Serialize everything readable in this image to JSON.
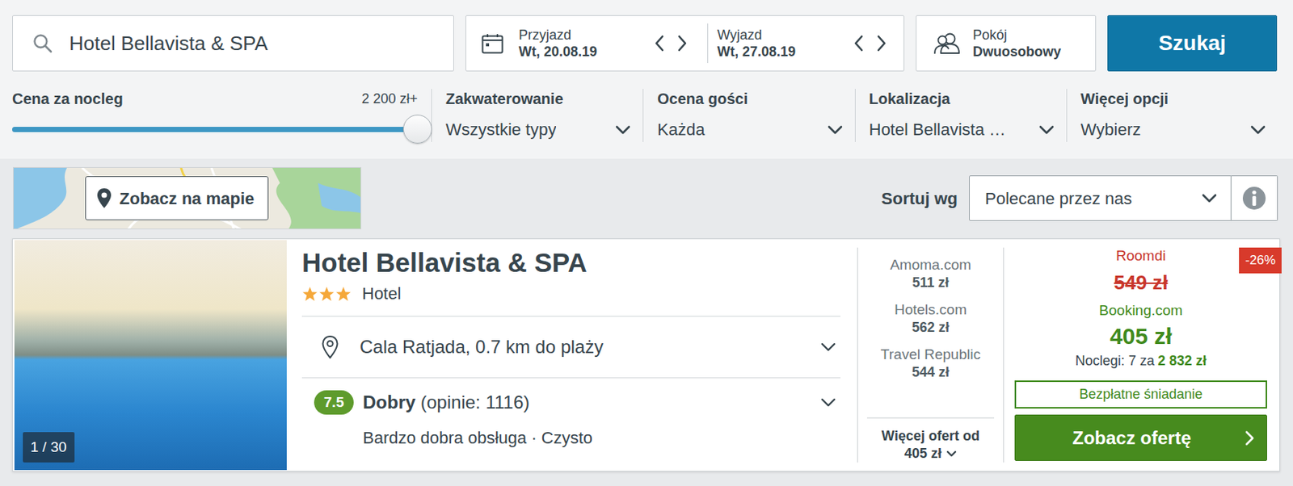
{
  "search": {
    "value": "Hotel Bellavista & SPA"
  },
  "dates": {
    "checkin": {
      "label": "Przyjazd",
      "value": "Wt, 20.08.19"
    },
    "checkout": {
      "label": "Wyjazd",
      "value": "Wt, 27.08.19"
    }
  },
  "room": {
    "label": "Pokój",
    "value": "Dwuosobowy"
  },
  "search_button": "Szukaj",
  "filters": {
    "price": {
      "label": "Cena za nocleg",
      "reading": "2 200 zł+",
      "level": 1
    },
    "dropdowns": [
      {
        "label": "Zakwaterowanie",
        "value": "Wszystkie typy"
      },
      {
        "label": "Ocena gości",
        "value": "Każda"
      },
      {
        "label": "Lokalizacja",
        "value": "Hotel Bellavista …"
      },
      {
        "label": "Więcej opcji",
        "value": "Wybierz"
      }
    ]
  },
  "map_button": "Zobacz na mapie",
  "sort": {
    "label": "Sortuj wg",
    "value": "Polecane przez nas"
  },
  "hotel": {
    "name": "Hotel Bellavista & SPA",
    "stars": 3,
    "type": "Hotel",
    "photo_counter": "1 / 30",
    "location": "Cala Ratjada, 0.7 km do plaży",
    "rating": {
      "score": "7.5",
      "word": "Dobry",
      "count": "(opinie: 1116)",
      "highlights": "Bardzo dobra obsługa · Czysto"
    },
    "offers": [
      {
        "site": "Amoma.com",
        "price": "511 zł"
      },
      {
        "site": "Hotels.com",
        "price": "562 zł"
      },
      {
        "site": "Travel Republic",
        "price": "544 zł"
      }
    ],
    "more_offers": {
      "label": "Więcej ofert od",
      "price": "405 zł"
    },
    "deal": {
      "discount": "-26%",
      "original_site": "Roomdi",
      "original_price": "549 zł",
      "site": "Booking.com",
      "price": "405 zł",
      "nights": "Noclegi: 7 za",
      "total": "2 832 zł",
      "perk": "Bezpłatne śniadanie",
      "button": "Zobacz ofertę"
    }
  }
}
